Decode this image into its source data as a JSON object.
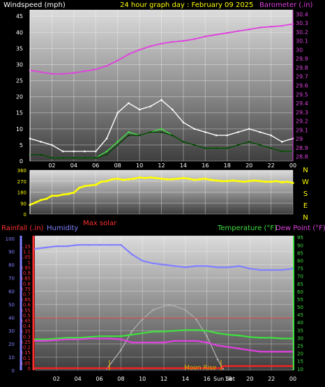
{
  "chart_data": [
    {
      "type": "line",
      "title": "24 hour graph day : February 09 2025",
      "left_axis_label": "Windspeed (mph)",
      "right_axis_label": "Barometer (.in)",
      "x_ticks": [
        "02",
        "04",
        "06",
        "08",
        "10",
        "12",
        "14",
        "16",
        "18",
        "20",
        "22",
        "00"
      ],
      "left_ticks": [
        "0",
        "5",
        "10",
        "15",
        "20",
        "25",
        "30",
        "35",
        "40",
        "45"
      ],
      "right_ticks": [
        "28.8",
        "28.9",
        "29",
        "29.1",
        "29.2",
        "29.3",
        "29.4",
        "29.5",
        "29.6",
        "29.7",
        "29.8",
        "29.9",
        "30",
        "30.1",
        "30.2",
        "30.3",
        "30.4"
      ],
      "ylim_left": [
        0,
        47
      ],
      "ylim_right": [
        28.75,
        30.45
      ],
      "grid": true,
      "series": [
        {
          "name": "Barometer",
          "axis": "right",
          "color": "#e040e0",
          "x": [
            0,
            1,
            2,
            3,
            4,
            5,
            6,
            7,
            8,
            9,
            10,
            11,
            12,
            13,
            14,
            15,
            16,
            17,
            18,
            19,
            20,
            21,
            22,
            23,
            24
          ],
          "values": [
            29.77,
            29.75,
            29.73,
            29.73,
            29.74,
            29.76,
            29.78,
            29.82,
            29.88,
            29.95,
            30.0,
            30.04,
            30.07,
            30.09,
            30.1,
            30.12,
            30.15,
            30.17,
            30.19,
            30.21,
            30.23,
            30.25,
            30.26,
            30.27,
            30.29
          ]
        },
        {
          "name": "Wind gust",
          "axis": "left",
          "color": "#ffffff",
          "x": [
            0,
            1,
            2,
            3,
            4,
            5,
            6,
            7,
            8,
            9,
            10,
            11,
            12,
            13,
            14,
            15,
            16,
            17,
            18,
            19,
            20,
            21,
            22,
            23,
            24
          ],
          "values": [
            7,
            6,
            5,
            3,
            3,
            3,
            3,
            7,
            15,
            18,
            16,
            17,
            19,
            16,
            12,
            10,
            9,
            8,
            8,
            9,
            10,
            9,
            8,
            6,
            7
          ]
        },
        {
          "name": "Wind speed",
          "axis": "left",
          "color": "#40e040",
          "x": [
            0,
            1,
            2,
            3,
            4,
            5,
            6,
            7,
            8,
            9,
            10,
            11,
            12,
            13,
            14,
            15,
            16,
            17,
            18,
            19,
            20,
            21,
            22,
            23,
            24
          ],
          "values": [
            2,
            2,
            1,
            1,
            1,
            1,
            1,
            3,
            6,
            9,
            8,
            9,
            10,
            8,
            6,
            5,
            4,
            4,
            4,
            5,
            6,
            5,
            4,
            3,
            3
          ]
        },
        {
          "name": "Wind avg",
          "axis": "left",
          "color": "#004000",
          "x": [
            0,
            1,
            2,
            3,
            4,
            5,
            6,
            7,
            8,
            9,
            10,
            11,
            12,
            13,
            14,
            15,
            16,
            17,
            18,
            19,
            20,
            21,
            22,
            23,
            24
          ],
          "values": [
            2,
            2,
            1,
            1,
            1,
            1,
            1,
            2,
            5,
            8,
            8,
            9,
            9,
            8,
            6,
            5,
            4,
            4,
            4,
            5,
            6,
            5,
            4,
            3,
            3
          ]
        }
      ]
    },
    {
      "type": "scatter",
      "left_ticks": [
        "0",
        "90",
        "180",
        "270",
        "360"
      ],
      "right_ticks": [
        "N",
        "W",
        "S",
        "E",
        "N"
      ],
      "x_ticks": [],
      "ylim_left": [
        0,
        360
      ],
      "grid": true,
      "series": [
        {
          "name": "Wind direction",
          "axis": "left",
          "color": "#ffff00",
          "x": [
            0,
            0.5,
            1,
            1.5,
            2,
            2.5,
            3,
            3.5,
            4,
            4.5,
            5,
            5.5,
            6,
            6.5,
            7,
            7.5,
            8,
            8.5,
            9,
            9.5,
            10,
            10.5,
            11,
            11.5,
            12,
            12.5,
            13,
            13.5,
            14,
            14.5,
            15,
            15.5,
            16,
            16.5,
            17,
            17.5,
            18,
            18.5,
            19,
            19.5,
            20,
            20.5,
            21,
            21.5,
            22,
            22.5,
            23,
            23.5,
            24
          ],
          "values": [
            75,
            95,
            115,
            125,
            150,
            150,
            160,
            165,
            175,
            215,
            230,
            235,
            240,
            265,
            270,
            285,
            290,
            280,
            285,
            290,
            300,
            295,
            300,
            295,
            290,
            285,
            285,
            290,
            295,
            290,
            280,
            285,
            290,
            280,
            275,
            270,
            270,
            275,
            270,
            265,
            270,
            275,
            270,
            265,
            265,
            270,
            260,
            265,
            255
          ]
        }
      ]
    },
    {
      "type": "line",
      "header_labels": [
        {
          "text": "Rainfall (.in)",
          "color": "#ff3030"
        },
        {
          "text": "Humidity",
          "color": "#8080ff"
        },
        {
          "text": "Max solar",
          "color": "#ff3030"
        },
        {
          "text": "Temperature (°F)",
          "color": "#40e040"
        },
        {
          "text": "Dew Point (°F)",
          "color": "#e040e0"
        }
      ],
      "humidity_ticks": [
        "0",
        "10",
        "20",
        "30",
        "40",
        "50",
        "60",
        "70",
        "80",
        "90",
        "100"
      ],
      "rain_ticks": [
        "0",
        "0.05",
        "0.1",
        "0.15",
        "0.2",
        "0.25",
        "0.3",
        "0.35",
        "0.4",
        "0.45",
        "0.5",
        "0.55",
        "0.6",
        "0.65",
        "0.7",
        "0.75",
        "0.8",
        "0.85",
        "0.9",
        "0.95",
        "1",
        "1.05",
        "1.1",
        "1.15"
      ],
      "temp_ticks": [
        "10",
        "15",
        "20",
        "25",
        "30",
        "35",
        "40",
        "45",
        "50",
        "55",
        "60",
        "65",
        "70",
        "75",
        "80",
        "85",
        "90",
        "95"
      ],
      "x_ticks": [
        "02",
        "04",
        "06",
        "08",
        "10",
        "12",
        "14",
        "16",
        "18",
        "20",
        "22",
        "00"
      ],
      "ylim_humidity": [
        0,
        102
      ],
      "ylim_temp": [
        9,
        96
      ],
      "annotations": [
        "Moon Rise",
        "Sun Set"
      ],
      "grid": true,
      "series": [
        {
          "name": "Humidity",
          "axis": "humidity",
          "color": "#8080ff",
          "x": [
            0,
            1,
            2,
            3,
            4,
            5,
            6,
            7,
            8,
            9,
            10,
            11,
            12,
            13,
            14,
            15,
            16,
            17,
            18,
            19,
            20,
            21,
            22,
            23,
            24
          ],
          "values": [
            92,
            93,
            94,
            94,
            95,
            95,
            95,
            95,
            95,
            88,
            83,
            81,
            80,
            79,
            78,
            79,
            79,
            78,
            78,
            79,
            77,
            76,
            76,
            76,
            77
          ]
        },
        {
          "name": "Temperature",
          "axis": "temp",
          "color": "#40e040",
          "x": [
            0,
            1,
            2,
            3,
            4,
            5,
            6,
            7,
            8,
            9,
            10,
            11,
            12,
            13,
            14,
            15,
            16,
            17,
            18,
            19,
            20,
            21,
            22,
            23,
            24
          ],
          "values": [
            29,
            29,
            29.5,
            30,
            30,
            30.5,
            31,
            31,
            31,
            32,
            33,
            34,
            34,
            34.5,
            35,
            35,
            34.5,
            33,
            32,
            31.5,
            30.5,
            30,
            30,
            29.5,
            29.5
          ]
        },
        {
          "name": "Dew Point",
          "axis": "temp",
          "color": "#e040e0",
          "x": [
            0,
            1,
            2,
            3,
            4,
            5,
            6,
            7,
            8,
            9,
            10,
            11,
            12,
            13,
            14,
            15,
            16,
            17,
            18,
            19,
            20,
            21,
            22,
            23,
            24
          ],
          "values": [
            28,
            28,
            28.5,
            29,
            29,
            29.5,
            29.5,
            29.5,
            29,
            27,
            27,
            27,
            27,
            28,
            28,
            28,
            27,
            25,
            24,
            23,
            22,
            21,
            21,
            21,
            21
          ]
        },
        {
          "name": "Max solar",
          "axis": "temp",
          "color": "#b0b0b0",
          "x": [
            6.7,
            8,
            9,
            10,
            11,
            12,
            12.5,
            13,
            14,
            15,
            16,
            17,
            17.5
          ],
          "values": [
            10,
            22,
            34,
            42,
            48,
            50.5,
            51,
            50.5,
            48,
            42,
            31,
            16,
            10
          ]
        },
        {
          "name": "Rainfall",
          "axis": "rain",
          "color": "#ff2020",
          "x": [
            0,
            17.4,
            17.5,
            24
          ],
          "values": [
            0,
            0,
            0.02,
            0.02
          ]
        }
      ]
    }
  ]
}
